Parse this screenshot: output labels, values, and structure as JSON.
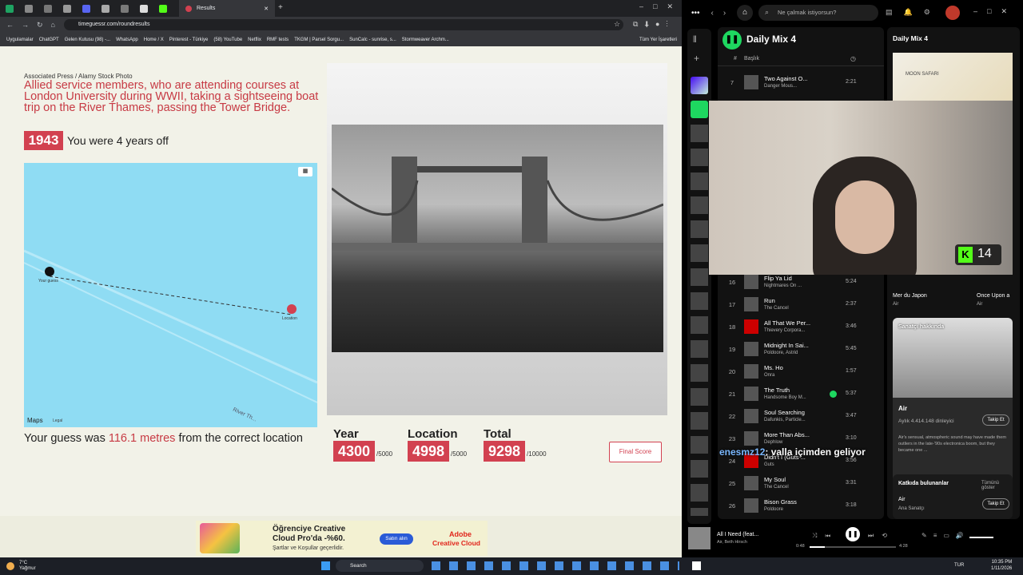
{
  "browser": {
    "active_tab": "Results",
    "url": "timeguessr.com/roundresults",
    "bookmarks": [
      "Uygulamalar",
      "ChatGPT",
      "Gelen Kutusu (98) -...",
      "WhatsApp",
      "Home / X",
      "Pinterest - Türkiye",
      "(58) YouTube",
      "Netflix",
      "RMF tests",
      "TKGM | Parsel Sorgu...",
      "SunCalc - sunrise, s...",
      "Stormweaver Archm...",
      "Tüm Yer İşaretleri"
    ]
  },
  "result": {
    "credit": "Associated Press / Alamy Stock Photo",
    "description": "Allied service members, who are attending courses at London University during WWII, taking a sightseeing boat trip on the River Thames, passing the Tower Bridge.",
    "year": "1943",
    "year_feedback": "You were 4 years off",
    "map_labels": {
      "guess": "Your guess",
      "location": "Location",
      "brand": "Maps",
      "legal": "Legal",
      "river": "River Th..."
    },
    "guess_prefix": "Your guess was ",
    "guess_distance": "116.1 metres",
    "guess_suffix": " from the correct location",
    "scores": [
      {
        "label": "Year",
        "value": "4300",
        "max": "/5000"
      },
      {
        "label": "Location",
        "value": "4998",
        "max": "/5000"
      },
      {
        "label": "Total",
        "value": "9298",
        "max": "/10000"
      }
    ],
    "final_button": "Final Score"
  },
  "ad": {
    "line1": "Öğrenciye Creative",
    "line2": "Cloud Pro'da -%60.",
    "line3": "Şartlar ve Koşullar geçerlidir.",
    "button": "Satın alın",
    "brand1": "Adobe",
    "brand2": "Creative Cloud",
    "tag": "AD"
  },
  "spotify": {
    "search_placeholder": "Ne çalmak istiyorsun?",
    "playlist": "Daily Mix 4",
    "header_title": "Başlık",
    "tracks": [
      {
        "num": "7",
        "title": "Two Against O...",
        "artist": "Danger Mous...",
        "dur": "2:21"
      },
      {
        "num": "16",
        "title": "Flip Ya Lid",
        "artist": "Nightmares On ...",
        "dur": "5:24"
      },
      {
        "num": "17",
        "title": "Run",
        "artist": "The Cancel",
        "dur": "2:37"
      },
      {
        "num": "18",
        "title": "All That We Per...",
        "artist": "Thievery Corpora...",
        "dur": "3:46"
      },
      {
        "num": "19",
        "title": "Midnight In Sai...",
        "artist": "Poldoore, Astrid",
        "dur": "5:45"
      },
      {
        "num": "20",
        "title": "Ms. Ho",
        "artist": "Onra",
        "dur": "1:57"
      },
      {
        "num": "21",
        "title": "The Truth",
        "artist": "Handsome Boy M...",
        "dur": "5:37"
      },
      {
        "num": "22",
        "title": "Soul Searching",
        "artist": "Dafunkis, Particle...",
        "dur": "3:47"
      },
      {
        "num": "23",
        "title": "More Than Abs...",
        "artist": "Dephlow",
        "dur": "3:10"
      },
      {
        "num": "24",
        "title": "Didn't I (Guts ...",
        "artist": "Guts",
        "dur": "3:56"
      },
      {
        "num": "25",
        "title": "My Soul",
        "artist": "The Cancel",
        "dur": "3:31"
      },
      {
        "num": "26",
        "title": "Bison Grass",
        "artist": "Poldoore",
        "dur": "3:18"
      }
    ],
    "right_title": "Daily Mix 4",
    "album_art_text": "MOON SAFARI",
    "cards": [
      {
        "title": "Mer du Japon",
        "sub": "Air"
      },
      {
        "title": "Once Upon a",
        "sub": "Air"
      }
    ],
    "about_header": "Sanatçı hakkında",
    "artist_name": "Air",
    "listeners": "Aylık 4.414.148 dinleyici",
    "follow_label": "Takip Et",
    "artist_bio": "Air's sensual, atmospheric sound may have made them outliers in the late-'90s electronica boom, but they became one ...",
    "credits_header": "Katkıda bulunanlar",
    "credits_all": "Tümünü göster",
    "credit_name": "Air",
    "credit_role": "Ana Sanatçı",
    "now_playing": "All I Need (feat...",
    "now_artist": "Air, Beth Hirsch",
    "time_elapsed": "0:48",
    "time_total": "4:28",
    "kick_count": "14"
  },
  "overlay": {
    "chat_user": "enesmz12",
    "chat_msg": ": valla içimden geliyor"
  },
  "taskbar": {
    "weather_temp": "7°C",
    "weather_text": "Yağmur",
    "search": "Search",
    "lang": "TUR",
    "time": "10:35 PM",
    "date": "1/11/2026"
  },
  "colors": {
    "accent": "#d24150",
    "spotify_green": "#1ed760",
    "map_water": "#8fdcf3"
  }
}
